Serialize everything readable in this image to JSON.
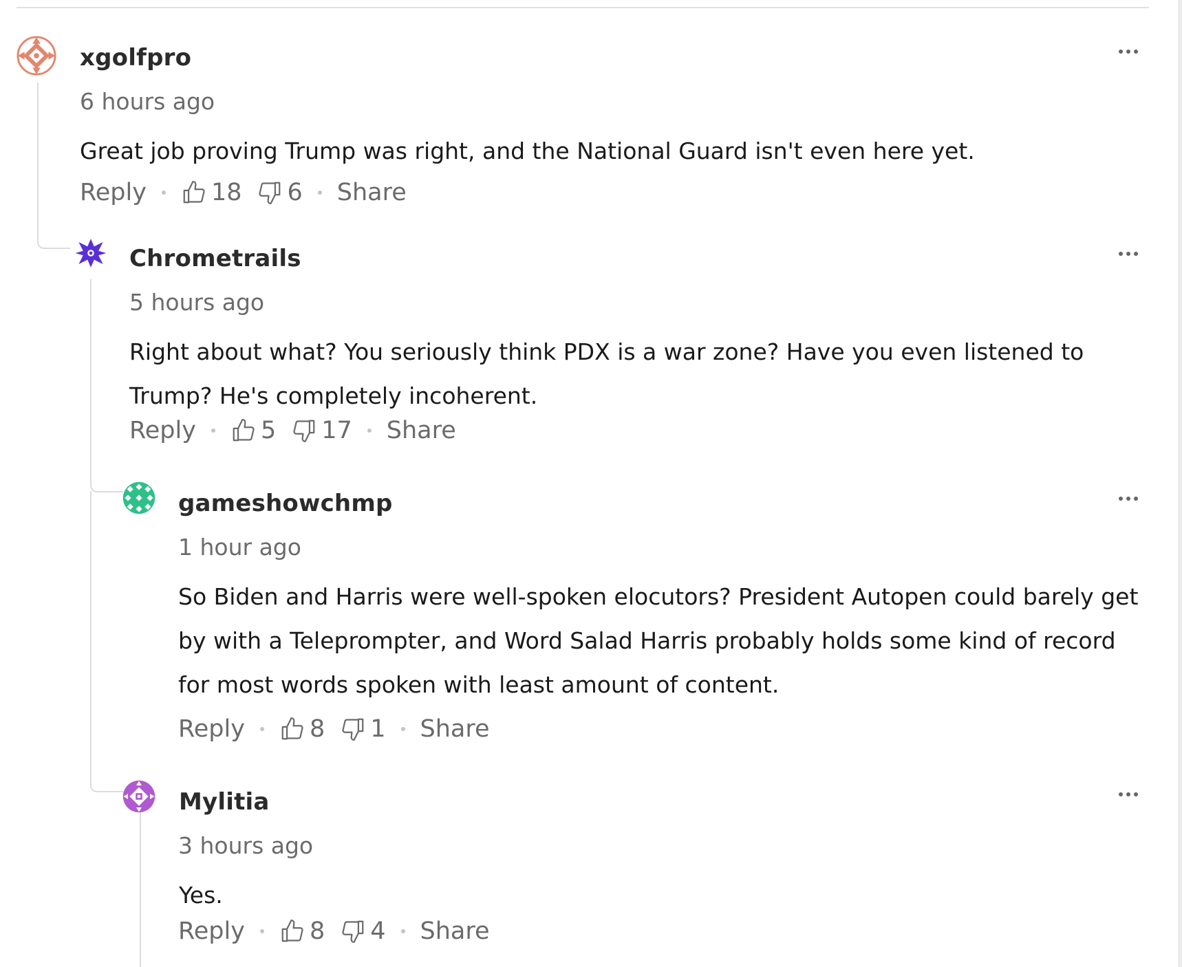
{
  "comments": [
    {
      "username": "xgolfpro",
      "time": "6 hours ago",
      "text": "Great job proving Trump was right, and the National Guard isn't even here yet.",
      "reply_label": "Reply",
      "likes": "18",
      "dislikes": "6",
      "share_label": "Share",
      "avatar_color": "#e0886f"
    },
    {
      "username": "Chrometrails",
      "time": "5 hours ago",
      "text": "Right about what? You seriously think PDX is a war zone? Have you even listened to Trump? He's completely incoherent.",
      "reply_label": "Reply",
      "likes": "5",
      "dislikes": "17",
      "share_label": "Share",
      "avatar_color": "#5a2fd6"
    },
    {
      "username": "gameshowchmp",
      "time": "1 hour ago",
      "text": "So Biden and Harris were well-spoken elocutors?  President Autopen could barely get by with a Teleprompter, and Word Salad Harris probably holds some kind of record for most words spoken with least amount of content.",
      "reply_label": "Reply",
      "likes": "8",
      "dislikes": "1",
      "share_label": "Share",
      "avatar_color": "#2fc08a"
    },
    {
      "username": "Mylitia",
      "time": "3 hours ago",
      "text": "Yes.",
      "reply_label": "Reply",
      "likes": "8",
      "dislikes": "4",
      "share_label": "Share",
      "avatar_color": "#b15ad0"
    }
  ]
}
